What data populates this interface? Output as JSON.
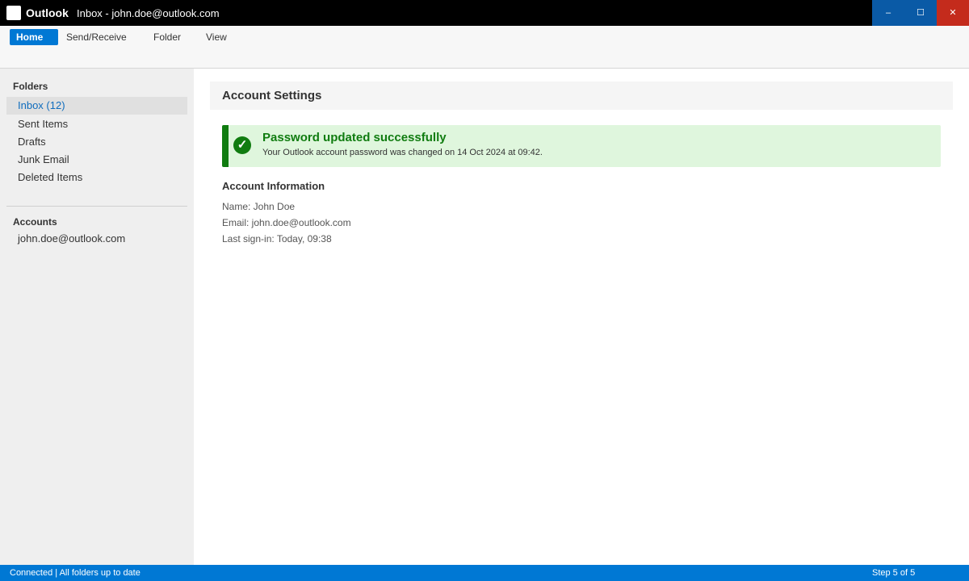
{
  "titlebar": {
    "app_name": "Outlook",
    "window_title": "Inbox - john.doe@outlook.com",
    "minimize": "–",
    "maximize": "☐",
    "close": "✕"
  },
  "ribbon": {
    "tabs": [
      "Home",
      "Send/Receive",
      "Folder",
      "View"
    ],
    "active_tab": "Home"
  },
  "sidebar": {
    "folders_heading": "Folders",
    "folders": [
      "Inbox (12)",
      "Sent Items",
      "Drafts",
      "Junk Email",
      "Deleted Items"
    ],
    "active_folder": "Inbox (12)",
    "accounts_heading": "Accounts",
    "accounts": [
      "john.doe@outlook.com"
    ]
  },
  "main": {
    "title": "Account Settings",
    "alert": {
      "icon": "check-icon",
      "glyph": "✓",
      "title": "Password updated successfully",
      "text": "Your Outlook account password was changed on 14 Oct 2024 at 09:42."
    },
    "info": {
      "heading": "Account Information",
      "name": "Name: John Doe",
      "email": "Email: john.doe@outlook.com",
      "last_signin": "Last sign-in: Today, 09:38"
    }
  },
  "statusbar": {
    "left": "Connected | All folders up to date",
    "right": "Step 5 of 5"
  },
  "colors": {
    "accent": "#0078d4",
    "success": "#107c10",
    "success_bg": "#dff6dd",
    "close": "#c42b1c"
  }
}
